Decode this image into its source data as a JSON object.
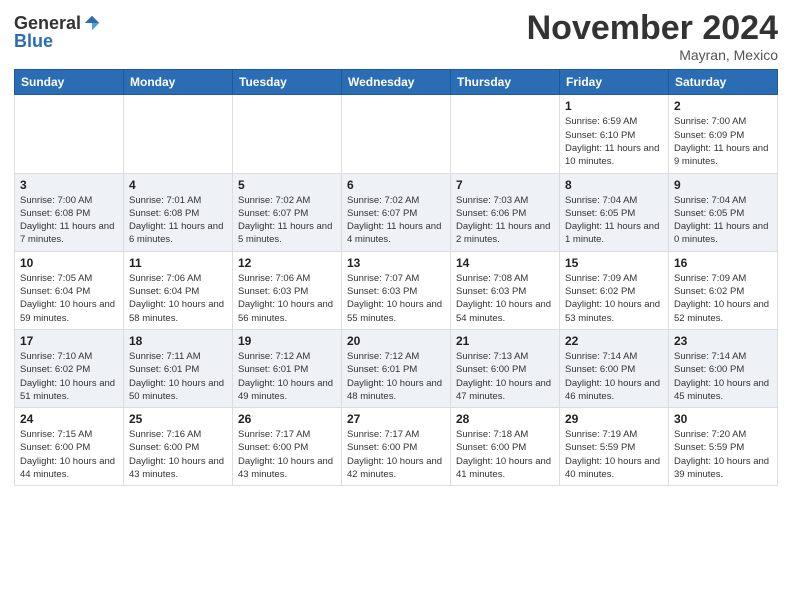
{
  "logo": {
    "general": "General",
    "blue": "Blue"
  },
  "header": {
    "month": "November 2024",
    "location": "Mayran, Mexico"
  },
  "weekdays": [
    "Sunday",
    "Monday",
    "Tuesday",
    "Wednesday",
    "Thursday",
    "Friday",
    "Saturday"
  ],
  "weeks": [
    [
      {
        "day": "",
        "info": ""
      },
      {
        "day": "",
        "info": ""
      },
      {
        "day": "",
        "info": ""
      },
      {
        "day": "",
        "info": ""
      },
      {
        "day": "",
        "info": ""
      },
      {
        "day": "1",
        "info": "Sunrise: 6:59 AM\nSunset: 6:10 PM\nDaylight: 11 hours and 10 minutes."
      },
      {
        "day": "2",
        "info": "Sunrise: 7:00 AM\nSunset: 6:09 PM\nDaylight: 11 hours and 9 minutes."
      }
    ],
    [
      {
        "day": "3",
        "info": "Sunrise: 7:00 AM\nSunset: 6:08 PM\nDaylight: 11 hours and 7 minutes."
      },
      {
        "day": "4",
        "info": "Sunrise: 7:01 AM\nSunset: 6:08 PM\nDaylight: 11 hours and 6 minutes."
      },
      {
        "day": "5",
        "info": "Sunrise: 7:02 AM\nSunset: 6:07 PM\nDaylight: 11 hours and 5 minutes."
      },
      {
        "day": "6",
        "info": "Sunrise: 7:02 AM\nSunset: 6:07 PM\nDaylight: 11 hours and 4 minutes."
      },
      {
        "day": "7",
        "info": "Sunrise: 7:03 AM\nSunset: 6:06 PM\nDaylight: 11 hours and 2 minutes."
      },
      {
        "day": "8",
        "info": "Sunrise: 7:04 AM\nSunset: 6:05 PM\nDaylight: 11 hours and 1 minute."
      },
      {
        "day": "9",
        "info": "Sunrise: 7:04 AM\nSunset: 6:05 PM\nDaylight: 11 hours and 0 minutes."
      }
    ],
    [
      {
        "day": "10",
        "info": "Sunrise: 7:05 AM\nSunset: 6:04 PM\nDaylight: 10 hours and 59 minutes."
      },
      {
        "day": "11",
        "info": "Sunrise: 7:06 AM\nSunset: 6:04 PM\nDaylight: 10 hours and 58 minutes."
      },
      {
        "day": "12",
        "info": "Sunrise: 7:06 AM\nSunset: 6:03 PM\nDaylight: 10 hours and 56 minutes."
      },
      {
        "day": "13",
        "info": "Sunrise: 7:07 AM\nSunset: 6:03 PM\nDaylight: 10 hours and 55 minutes."
      },
      {
        "day": "14",
        "info": "Sunrise: 7:08 AM\nSunset: 6:03 PM\nDaylight: 10 hours and 54 minutes."
      },
      {
        "day": "15",
        "info": "Sunrise: 7:09 AM\nSunset: 6:02 PM\nDaylight: 10 hours and 53 minutes."
      },
      {
        "day": "16",
        "info": "Sunrise: 7:09 AM\nSunset: 6:02 PM\nDaylight: 10 hours and 52 minutes."
      }
    ],
    [
      {
        "day": "17",
        "info": "Sunrise: 7:10 AM\nSunset: 6:02 PM\nDaylight: 10 hours and 51 minutes."
      },
      {
        "day": "18",
        "info": "Sunrise: 7:11 AM\nSunset: 6:01 PM\nDaylight: 10 hours and 50 minutes."
      },
      {
        "day": "19",
        "info": "Sunrise: 7:12 AM\nSunset: 6:01 PM\nDaylight: 10 hours and 49 minutes."
      },
      {
        "day": "20",
        "info": "Sunrise: 7:12 AM\nSunset: 6:01 PM\nDaylight: 10 hours and 48 minutes."
      },
      {
        "day": "21",
        "info": "Sunrise: 7:13 AM\nSunset: 6:00 PM\nDaylight: 10 hours and 47 minutes."
      },
      {
        "day": "22",
        "info": "Sunrise: 7:14 AM\nSunset: 6:00 PM\nDaylight: 10 hours and 46 minutes."
      },
      {
        "day": "23",
        "info": "Sunrise: 7:14 AM\nSunset: 6:00 PM\nDaylight: 10 hours and 45 minutes."
      }
    ],
    [
      {
        "day": "24",
        "info": "Sunrise: 7:15 AM\nSunset: 6:00 PM\nDaylight: 10 hours and 44 minutes."
      },
      {
        "day": "25",
        "info": "Sunrise: 7:16 AM\nSunset: 6:00 PM\nDaylight: 10 hours and 43 minutes."
      },
      {
        "day": "26",
        "info": "Sunrise: 7:17 AM\nSunset: 6:00 PM\nDaylight: 10 hours and 43 minutes."
      },
      {
        "day": "27",
        "info": "Sunrise: 7:17 AM\nSunset: 6:00 PM\nDaylight: 10 hours and 42 minutes."
      },
      {
        "day": "28",
        "info": "Sunrise: 7:18 AM\nSunset: 6:00 PM\nDaylight: 10 hours and 41 minutes."
      },
      {
        "day": "29",
        "info": "Sunrise: 7:19 AM\nSunset: 5:59 PM\nDaylight: 10 hours and 40 minutes."
      },
      {
        "day": "30",
        "info": "Sunrise: 7:20 AM\nSunset: 5:59 PM\nDaylight: 10 hours and 39 minutes."
      }
    ]
  ]
}
